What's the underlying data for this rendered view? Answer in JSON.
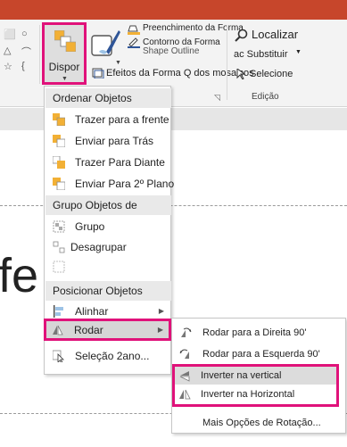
{
  "ribbon": {
    "arrange_label": "Dispor",
    "shape_fill": "Preenchimento da Forma",
    "shape_outline": "Contorno da Forma",
    "shape_outline_overlap": "Shape Outline",
    "shape_effects": "Efeitos da Forma Q dos mosaicos",
    "find": "Localizar",
    "replace": "ac Substituir",
    "select": "Selecione",
    "editing_group": "Edição"
  },
  "menu": {
    "order_header": "Ordenar Objetos",
    "bring_to_front": "Trazer para a frente",
    "send_to_back": "Enviar para Trás",
    "bring_forward": "Trazer Para Diante",
    "send_backward": "Enviar Para 2º Plano",
    "group_header": "Grupo Objetos de",
    "group": "Grupo",
    "ungroup": "Desagrupar",
    "position_header": "Posicionar Objetos",
    "align": "Alinhar",
    "rotate": "Rodar",
    "selection_pane": "Seleção 2ano..."
  },
  "submenu": {
    "rotate_right": "Rodar para a Direita 90'",
    "rotate_left": "Rodar para a Esquerda 90'",
    "flip_vertical": "Inverter na vertical",
    "flip_horizontal": "Inverter na Horizontal",
    "more_options": "Mais Opções de Rotação..."
  },
  "slide": {
    "partial_text": "fe"
  },
  "colors": {
    "title_bar": "#c7462b",
    "highlight_border": "#e0127a",
    "icon_orange": "#f2b035"
  }
}
